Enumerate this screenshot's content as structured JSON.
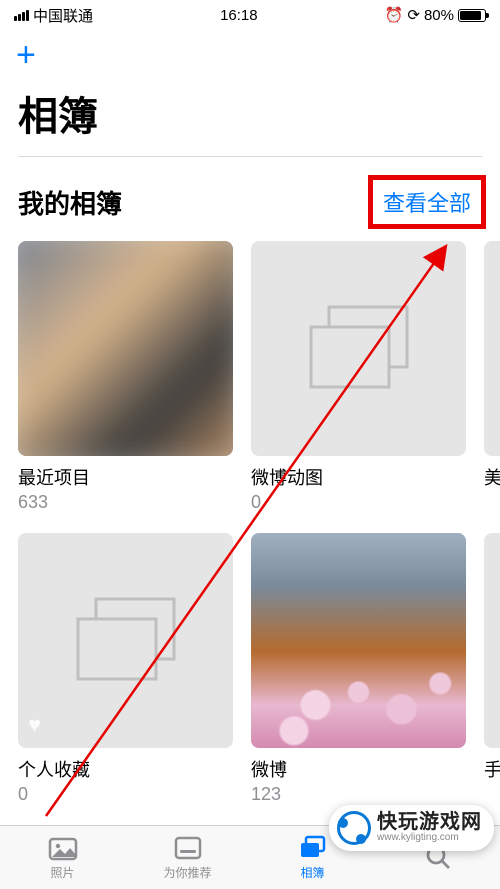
{
  "status": {
    "carrier": "中国联通",
    "time": "16:18",
    "battery_pct": "80%"
  },
  "toolbar": {
    "add_label": "+"
  },
  "page_title": "相簿",
  "section": {
    "title": "我的相簿",
    "see_all": "查看全部"
  },
  "albums_row1": [
    {
      "name": "最近项目",
      "count": "633"
    },
    {
      "name": "微博动图",
      "count": "0"
    },
    {
      "name": "美",
      "count": ""
    }
  ],
  "albums_row2": [
    {
      "name": "个人收藏",
      "count": "0"
    },
    {
      "name": "微博",
      "count": "123"
    },
    {
      "name": "手",
      "count": ""
    }
  ],
  "tabs": [
    {
      "label": "照片"
    },
    {
      "label": "为你推荐"
    },
    {
      "label": "相簿"
    },
    {
      "label": ""
    }
  ],
  "watermark": {
    "title": "快玩游戏网",
    "url": "www.kyligting.com"
  }
}
